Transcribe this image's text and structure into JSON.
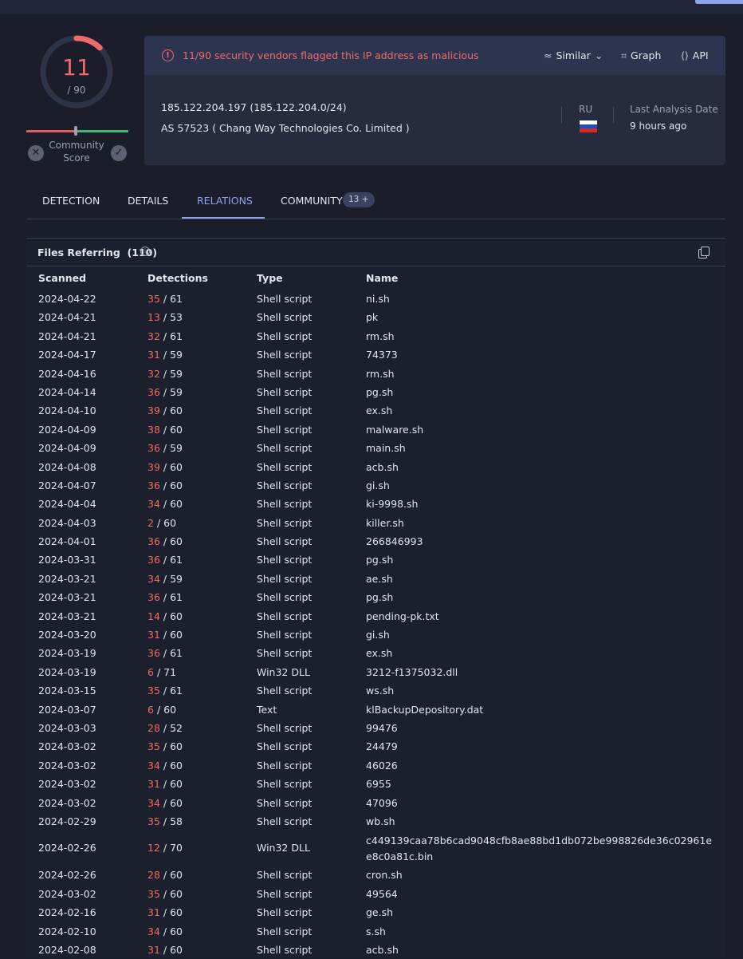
{
  "score": {
    "detected": "11",
    "total": "/ 90",
    "community_label": "Community Score"
  },
  "alert": {
    "text": "11/90 security vendors flagged this IP address as malicious",
    "color": "#ef6b6b"
  },
  "actions": {
    "similar": "Similar",
    "graph": "Graph",
    "api": "API"
  },
  "ip": {
    "address": "185.122.204.197  (185.122.204.0/24)",
    "as": "AS 57523  ( Chang Way Technologies Co. Limited )",
    "country": "RU"
  },
  "analysis": {
    "label": "Last Analysis Date",
    "value": "9 hours ago"
  },
  "tabs": {
    "detection": "DETECTION",
    "details": "DETAILS",
    "relations": "RELATIONS",
    "community": "COMMUNITY",
    "community_badge": "13 +"
  },
  "files": {
    "title": "Files Referring",
    "count": "(110)",
    "columns": [
      "Scanned",
      "Detections",
      "Type",
      "Name"
    ],
    "rows": [
      {
        "scanned": "2024-04-22",
        "det": "35",
        "total": "/ 61",
        "type": "Shell script",
        "name": "ni.sh"
      },
      {
        "scanned": "2024-04-21",
        "det": "13",
        "total": "/ 53",
        "type": "Shell script",
        "name": "pk"
      },
      {
        "scanned": "2024-04-21",
        "det": "32",
        "total": "/ 61",
        "type": "Shell script",
        "name": "rm.sh"
      },
      {
        "scanned": "2024-04-17",
        "det": "31",
        "total": "/ 59",
        "type": "Shell script",
        "name": "74373"
      },
      {
        "scanned": "2024-04-16",
        "det": "32",
        "total": "/ 59",
        "type": "Shell script",
        "name": "rm.sh"
      },
      {
        "scanned": "2024-04-14",
        "det": "36",
        "total": "/ 59",
        "type": "Shell script",
        "name": "pg.sh"
      },
      {
        "scanned": "2024-04-10",
        "det": "39",
        "total": "/ 60",
        "type": "Shell script",
        "name": "ex.sh"
      },
      {
        "scanned": "2024-04-09",
        "det": "38",
        "total": "/ 60",
        "type": "Shell script",
        "name": "malware.sh"
      },
      {
        "scanned": "2024-04-09",
        "det": "36",
        "total": "/ 59",
        "type": "Shell script",
        "name": "main.sh"
      },
      {
        "scanned": "2024-04-08",
        "det": "39",
        "total": "/ 60",
        "type": "Shell script",
        "name": "acb.sh"
      },
      {
        "scanned": "2024-04-07",
        "det": "36",
        "total": "/ 60",
        "type": "Shell script",
        "name": "gi.sh"
      },
      {
        "scanned": "2024-04-04",
        "det": "34",
        "total": "/ 60",
        "type": "Shell script",
        "name": "ki-9998.sh"
      },
      {
        "scanned": "2024-04-03",
        "det": "2",
        "total": "/ 60",
        "type": "Shell script",
        "name": "killer.sh"
      },
      {
        "scanned": "2024-04-01",
        "det": "36",
        "total": "/ 60",
        "type": "Shell script",
        "name": "266846993"
      },
      {
        "scanned": "2024-03-31",
        "det": "36",
        "total": "/ 61",
        "type": "Shell script",
        "name": "pg.sh"
      },
      {
        "scanned": "2024-03-21",
        "det": "34",
        "total": "/ 59",
        "type": "Shell script",
        "name": "ae.sh"
      },
      {
        "scanned": "2024-03-21",
        "det": "36",
        "total": "/ 61",
        "type": "Shell script",
        "name": "pg.sh"
      },
      {
        "scanned": "2024-03-21",
        "det": "14",
        "total": "/ 60",
        "type": "Shell script",
        "name": "pending-pk.txt"
      },
      {
        "scanned": "2024-03-20",
        "det": "31",
        "total": "/ 60",
        "type": "Shell script",
        "name": "gi.sh"
      },
      {
        "scanned": "2024-03-19",
        "det": "36",
        "total": "/ 61",
        "type": "Shell script",
        "name": "ex.sh"
      },
      {
        "scanned": "2024-03-19",
        "det": "6",
        "total": "/ 71",
        "type": "Win32 DLL",
        "name": "3212-f1375032.dll"
      },
      {
        "scanned": "2024-03-15",
        "det": "35",
        "total": "/ 61",
        "type": "Shell script",
        "name": "ws.sh"
      },
      {
        "scanned": "2024-03-07",
        "det": "6",
        "total": "/ 60",
        "type": "Text",
        "name": "klBackupDepository.dat"
      },
      {
        "scanned": "2024-03-03",
        "det": "28",
        "total": "/ 52",
        "type": "Shell script",
        "name": "99476"
      },
      {
        "scanned": "2024-03-02",
        "det": "35",
        "total": "/ 60",
        "type": "Shell script",
        "name": "24479"
      },
      {
        "scanned": "2024-03-02",
        "det": "34",
        "total": "/ 60",
        "type": "Shell script",
        "name": "46026"
      },
      {
        "scanned": "2024-03-02",
        "det": "31",
        "total": "/ 60",
        "type": "Shell script",
        "name": "6955"
      },
      {
        "scanned": "2024-03-02",
        "det": "34",
        "total": "/ 60",
        "type": "Shell script",
        "name": "47096"
      },
      {
        "scanned": "2024-02-29",
        "det": "35",
        "total": "/ 58",
        "type": "Shell script",
        "name": "wb.sh"
      },
      {
        "scanned": "2024-02-26",
        "det": "12",
        "total": "/ 70",
        "type": "Win32 DLL",
        "name": "c449139caa78b6cad9048cfb8ae88bd1db072be998826de36c02961ee8c0a81c.bin",
        "tall": true
      },
      {
        "scanned": "2024-02-26",
        "det": "28",
        "total": "/ 60",
        "type": "Shell script",
        "name": "cron.sh"
      },
      {
        "scanned": "2024-03-02",
        "det": "35",
        "total": "/ 60",
        "type": "Shell script",
        "name": "49564"
      },
      {
        "scanned": "2024-02-16",
        "det": "31",
        "total": "/ 60",
        "type": "Shell script",
        "name": "ge.sh"
      },
      {
        "scanned": "2024-02-10",
        "det": "34",
        "total": "/ 60",
        "type": "Shell script",
        "name": "s.sh"
      },
      {
        "scanned": "2024-02-08",
        "det": "31",
        "total": "/ 60",
        "type": "Shell script",
        "name": "acb.sh"
      }
    ]
  },
  "colors": {
    "malicious": "#ef6b6b",
    "accent": "#8fa4e8",
    "background": "#1b1d2a"
  }
}
